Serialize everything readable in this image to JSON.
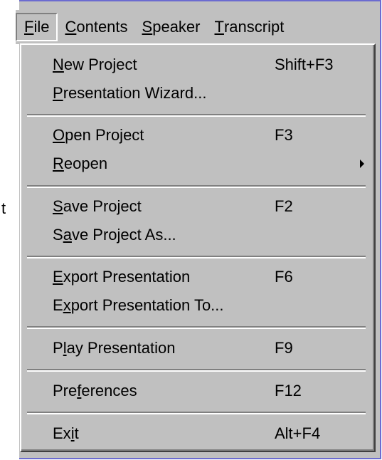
{
  "menubar": {
    "items": [
      {
        "label_pre": "",
        "label_u": "F",
        "label_post": "ile"
      },
      {
        "label_pre": "",
        "label_u": "C",
        "label_post": "ontents"
      },
      {
        "label_pre": "",
        "label_u": "S",
        "label_post": "peaker"
      },
      {
        "label_pre": "",
        "label_u": "T",
        "label_post": "ranscript"
      }
    ]
  },
  "background": {
    "partial_text": "t"
  },
  "file_menu": {
    "new_project": {
      "pre": "",
      "u": "N",
      "post": "ew Project",
      "shortcut": "Shift+F3"
    },
    "presentation_wizard": {
      "pre": "",
      "u": "P",
      "post": "resentation Wizard...",
      "shortcut": ""
    },
    "open_project": {
      "pre": "",
      "u": "O",
      "post": "pen Project",
      "shortcut": "F3"
    },
    "reopen": {
      "pre": "",
      "u": "R",
      "post": "eopen",
      "shortcut": ""
    },
    "save_project": {
      "pre": "",
      "u": "S",
      "post": "ave Project",
      "shortcut": "F2"
    },
    "save_project_as": {
      "pre": "S",
      "u": "a",
      "post": "ve Project As...",
      "shortcut": ""
    },
    "export_presentation": {
      "pre": "",
      "u": "E",
      "post": "xport Presentation",
      "shortcut": "F6"
    },
    "export_presentation_to": {
      "pre": "E",
      "u": "x",
      "post": "port Presentation To...",
      "shortcut": ""
    },
    "play_presentation": {
      "pre": "P",
      "u": "l",
      "post": "ay Presentation",
      "shortcut": "F9"
    },
    "preferences": {
      "pre": "Pre",
      "u": "f",
      "post": "erences",
      "shortcut": "F12"
    },
    "exit": {
      "pre": "Ex",
      "u": "i",
      "post": "t",
      "shortcut": "Alt+F4"
    }
  }
}
